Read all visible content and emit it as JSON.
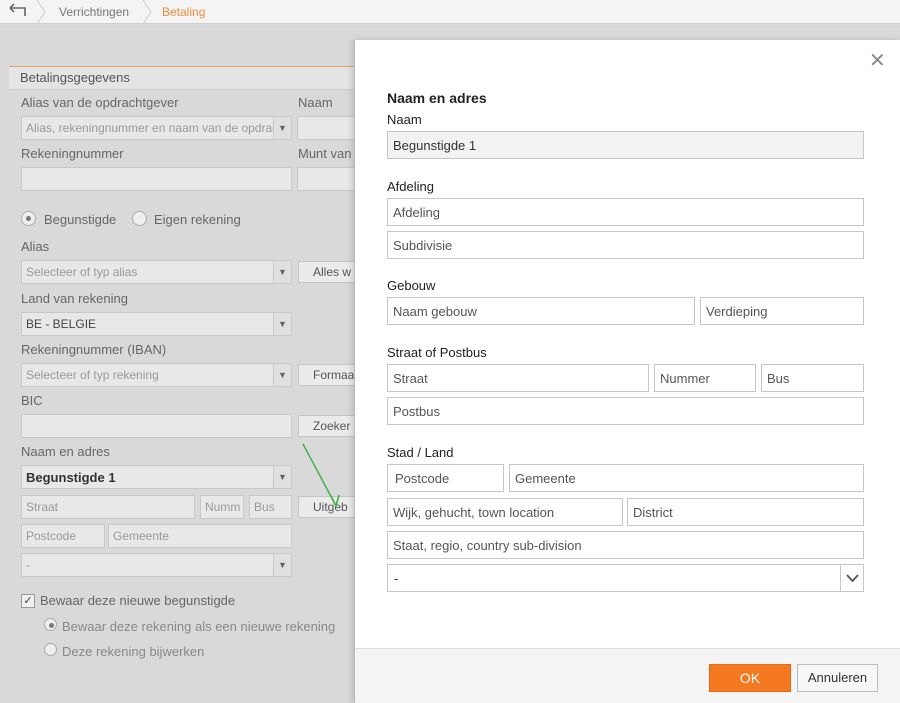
{
  "breadcrumb": {
    "items": [
      "Verrichtingen",
      "Betaling"
    ]
  },
  "background": {
    "section_title": "Betalingsgegevens",
    "alias_opdrachtgever_label": "Alias van de opdrachtgever",
    "alias_opdrachtgever_placeholder": "Alias, rekeningnummer en naam van de opdrachtgever",
    "naam_label": "Naam",
    "rekeningnummer_label": "Rekeningnummer",
    "munt_label": "Munt van",
    "radio_begunstigde": "Begunstigde",
    "radio_eigen": "Eigen rekening",
    "alias_label": "Alias",
    "alias_select": "Selecteer of typ alias",
    "alles_button": "Alles w",
    "land_label": "Land van rekening",
    "land_select": "BE - BELGIE",
    "iban_label": "Rekeningnummer (IBAN)",
    "iban_select": "Selecteer of typ rekening",
    "format_button": "Formaa",
    "bic_label": "BIC",
    "zoeken_button": "Zoeker",
    "naam_adres_label": "Naam en adres",
    "naam_adres_select": "Begunstigde 1",
    "straat": "Straat",
    "nummer": "Numm",
    "bus": "Bus",
    "uitgebreid_button": "Uitgeb",
    "postcode": "Postcode",
    "gemeente": "Gemeente",
    "country_select": "-",
    "bewaar_check": "Bewaar deze nieuwe begunstigde",
    "bewaar_nieuw": "Bewaar deze rekening als een nieuwe rekening",
    "bijwerken": "Deze rekening bijwerken"
  },
  "modal": {
    "title": "Naam en adres",
    "naam_label": "Naam",
    "naam_value": "Begunstigde 1",
    "afdeling_label": "Afdeling",
    "afdeling_placeholder": "Afdeling",
    "subdivisie_placeholder": "Subdivisie",
    "gebouw_label": "Gebouw",
    "naam_gebouw_placeholder": "Naam gebouw",
    "verdieping_placeholder": "Verdieping",
    "straat_label": "Straat of Postbus",
    "straat_placeholder": "Straat",
    "nummer_placeholder": "Nummer",
    "bus_placeholder": "Bus",
    "postbus_placeholder": "Postbus",
    "stad_label": "Stad / Land",
    "postcode_placeholder": "Postcode",
    "gemeente_placeholder": "Gemeente",
    "wijk_placeholder": "Wijk, gehucht, town location",
    "district_placeholder": "District",
    "staat_placeholder": "Staat, regio, country sub-division",
    "country_value": "-",
    "ok_label": "OK",
    "cancel_label": "Annuleren"
  },
  "colors": {
    "accent": "#f47920",
    "breadcrumb_active": "#f08a3c"
  }
}
